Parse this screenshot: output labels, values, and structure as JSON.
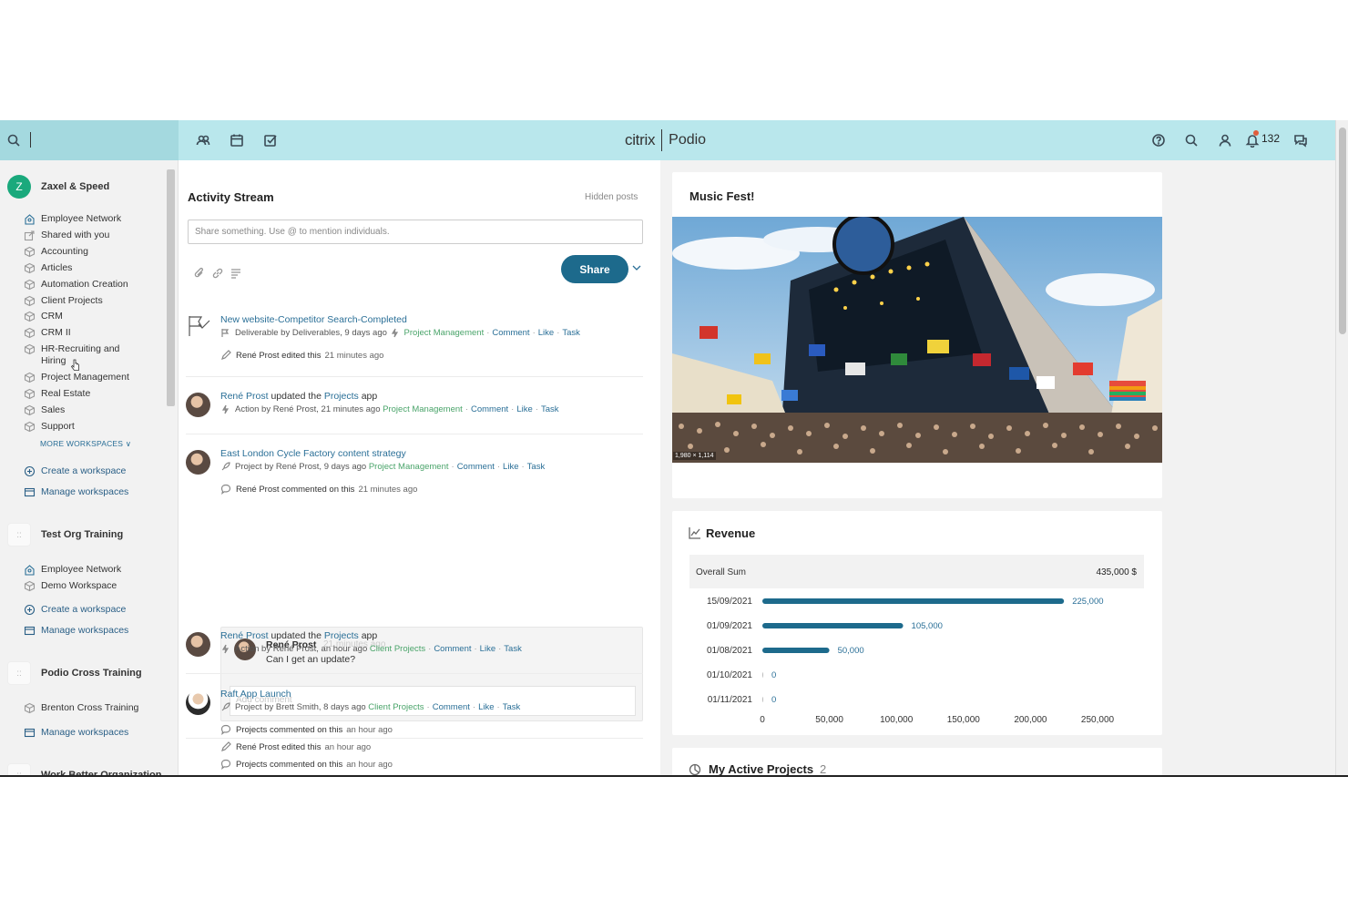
{
  "brand": {
    "citrix": "citrix",
    "podio": "Podio"
  },
  "topbar": {
    "notifications_count": "132"
  },
  "sidebar": {
    "orgs": [
      {
        "name": "Zaxel & Speed",
        "badge": "Z",
        "workspaces": [
          "Employee Network",
          "Shared with you",
          "Accounting",
          "Articles",
          "Automation Creation",
          "Client Projects",
          "CRM",
          "CRM II",
          "HR-Recruiting and Hiring",
          "Project Management",
          "Real Estate",
          "Sales",
          "Support"
        ],
        "more_label": "MORE WORKSPACES",
        "create_label": "Create a workspace",
        "manage_label": "Manage workspaces"
      },
      {
        "name": "Test Org Training",
        "workspaces": [
          "Employee Network",
          "Demo Workspace"
        ],
        "create_label": "Create a workspace",
        "manage_label": "Manage workspaces"
      },
      {
        "name": "Podio Cross Training",
        "workspaces": [
          "Brenton Cross Training"
        ],
        "manage_label": "Manage workspaces"
      },
      {
        "name": "Work Better Organization"
      }
    ]
  },
  "activity": {
    "title": "Activity Stream",
    "hidden_posts": "Hidden posts",
    "share_placeholder": "Share something. Use @ to mention individuals.",
    "share_button": "Share",
    "items": [
      {
        "title": "New website-Competitor Search-Completed",
        "meta_type": "Deliverable",
        "meta_by": "by",
        "meta_author": "Deliverables, 9 days ago",
        "workspace": "Project Management",
        "actions": [
          "Comment",
          "Like",
          "Task"
        ],
        "sub": [
          {
            "text": "René Prost edited this",
            "time": "21 minutes ago"
          }
        ]
      },
      {
        "actor": "René Prost",
        "verb": "updated the",
        "object": "Projects",
        "suffix": "app",
        "meta_type": "Action",
        "meta_by": "by",
        "meta_author": "René Prost, 21 minutes ago",
        "workspace": "Project Management",
        "actions": [
          "Comment",
          "Like",
          "Task"
        ]
      },
      {
        "title": "East London Cycle Factory content strategy",
        "meta_type": "Project",
        "meta_by": "by",
        "meta_author": "René Prost, 9 days ago",
        "workspace": "Project Management",
        "actions": [
          "Comment",
          "Like",
          "Task"
        ],
        "sub": [
          {
            "text": "René Prost commented on this",
            "time": "21 minutes ago"
          }
        ],
        "comment": {
          "author": "René Prost",
          "time": "21 minutes ago",
          "text": "Can I get an update?",
          "add_placeholder": "Add comment"
        }
      },
      {
        "actor": "René Prost",
        "verb": "updated the",
        "object": "Projects",
        "suffix": "app",
        "meta_type": "Action",
        "meta_by": "by",
        "meta_author": "René Prost, an hour ago",
        "workspace": "Client Projects",
        "actions": [
          "Comment",
          "Like",
          "Task"
        ]
      },
      {
        "title": "Raft App Launch",
        "meta_type": "Project",
        "meta_by": "by",
        "meta_author": "Brett Smith, 8 days ago",
        "workspace": "Client Projects",
        "actions": [
          "Comment",
          "Like",
          "Task"
        ],
        "sub": [
          {
            "text": "Projects commented on this",
            "time": "an hour ago"
          },
          {
            "text": "René Prost edited this",
            "time": "an hour ago"
          },
          {
            "text": "Projects commented on this",
            "time": "an hour ago"
          }
        ]
      }
    ]
  },
  "music_card": {
    "title": "Music Fest!",
    "image_dims": "1,980 × 1,114"
  },
  "revenue": {
    "title": "Revenue",
    "overall_label": "Overall Sum",
    "overall_value": "435,000 $",
    "bar_color": "#1d6a8c"
  },
  "chart_data": {
    "type": "bar",
    "orientation": "horizontal",
    "categories": [
      "15/09/2021",
      "01/09/2021",
      "01/08/2021",
      "01/10/2021",
      "01/11/2021"
    ],
    "values": [
      225000,
      105000,
      50000,
      0,
      0
    ],
    "value_labels": [
      "225,000",
      "105,000",
      "50,000",
      "0",
      "0"
    ],
    "xlim": [
      0,
      250000
    ],
    "xticks": [
      "0",
      "50,000",
      "100,000",
      "150,000",
      "200,000",
      "250,000"
    ]
  },
  "projects_card": {
    "title": "My Active Projects",
    "count": "2"
  }
}
